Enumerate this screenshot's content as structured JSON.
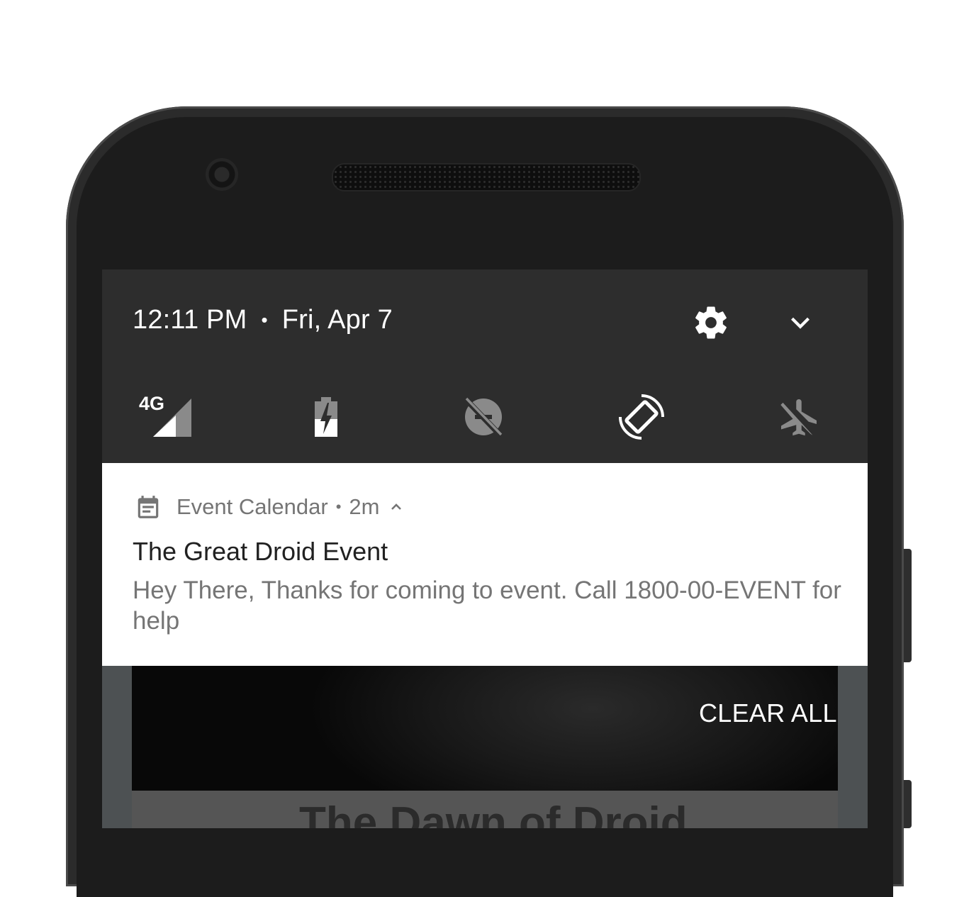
{
  "status": {
    "time": "12:11 PM",
    "separator": "•",
    "date": "Fri, Apr 7"
  },
  "quick_settings": {
    "network_label": "4G",
    "tiles": [
      {
        "icon": "signal-4g-icon",
        "active": true
      },
      {
        "icon": "battery-charging-icon",
        "active": true
      },
      {
        "icon": "data-saver-off-icon",
        "active": false
      },
      {
        "icon": "auto-rotate-icon",
        "active": true
      },
      {
        "icon": "airplane-mode-off-icon",
        "active": false
      }
    ]
  },
  "notification": {
    "app_name": "Event Calendar",
    "separator": "•",
    "time_ago": "2m",
    "title": "The Great Droid Event",
    "body": "Hey There, Thanks for coming to event. Call 1800-00-EVENT for help"
  },
  "background_card": {
    "title": "The Dawn of Droid"
  },
  "actions": {
    "clear_all": "CLEAR ALL"
  },
  "colors": {
    "shade": "#2d2d2d",
    "notification_bg": "#ffffff",
    "icon_active": "#ffffff",
    "icon_inactive": "#8a8a8a"
  }
}
